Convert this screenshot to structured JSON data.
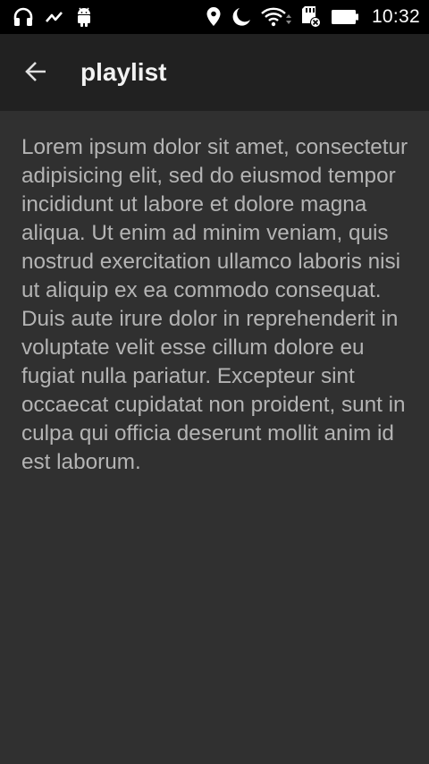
{
  "status_bar": {
    "time": "10:32",
    "left_icons": [
      "headphones-icon",
      "activity-icon",
      "android-icon"
    ],
    "right_icons": [
      "location-icon",
      "do-not-disturb-moon-icon",
      "wifi-icon",
      "sd-card-error-icon",
      "battery-icon"
    ]
  },
  "app_bar": {
    "back_icon": "arrow-back-icon",
    "title": "playlist"
  },
  "content": {
    "body": "Lorem ipsum dolor sit amet, consectetur adipisicing elit, sed do eiusmod tempor incididunt ut labore et dolore magna aliqua. Ut enim ad minim veniam, quis nostrud exercitation ullamco laboris nisi ut aliquip ex ea commodo consequat. Duis aute irure dolor in reprehenderit in voluptate velit esse cillum dolore eu fugiat nulla pariatur. Excepteur sint occaecat cupidatat non proident, sunt in culpa qui officia deserunt mollit anim id est laborum."
  },
  "colors": {
    "status_bar_bg": "#000000",
    "app_bar_bg": "#212121",
    "page_bg": "#303030",
    "title_text": "#f2f2f2",
    "body_text": "#b4b4b4"
  }
}
